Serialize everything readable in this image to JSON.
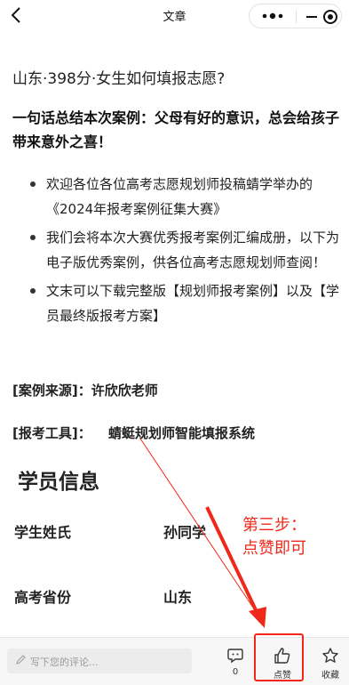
{
  "nav": {
    "title": "文章"
  },
  "article": {
    "question": "山东·398分·女生如何填报志愿?",
    "summary": "一句话总结本次案例：父母有好的意识，总会给孩子带来意外之喜！",
    "bullets": [
      "欢迎各位各位高考志愿规划师投稿蜻学举办的《2024年报考案例征集大赛》",
      "我们会将本次大赛优秀报考案例汇编成册，以下为电子版优秀案例，供各位高考志愿规划师查阅！",
      "文末可以下载完整版【规划师报考案例】以及【学员最终版报考方案】"
    ],
    "source": "[案例来源]：许欣欣老师",
    "tool_label": "[报考工具]：",
    "tool_value": "蜻蜓规划师智能填报系统",
    "section_title": "学员信息",
    "fields": [
      {
        "label": "学生姓氏",
        "value": "孙同学"
      },
      {
        "label": "高考省份",
        "value": "山东"
      }
    ]
  },
  "annotation": {
    "line1": "第三步：",
    "line2": "点赞即可",
    "color": "#f0281a"
  },
  "bottom_bar": {
    "comment_placeholder": "写下您的评论...",
    "comment_count": "0",
    "like_label": "点赞",
    "collect_label": "收藏"
  },
  "icons": [
    "back-arrow-icon",
    "more-dots-icon",
    "minimize-icon",
    "close-target-icon",
    "pencil-icon",
    "comment-icon",
    "thumbs-up-icon",
    "star-icon"
  ]
}
